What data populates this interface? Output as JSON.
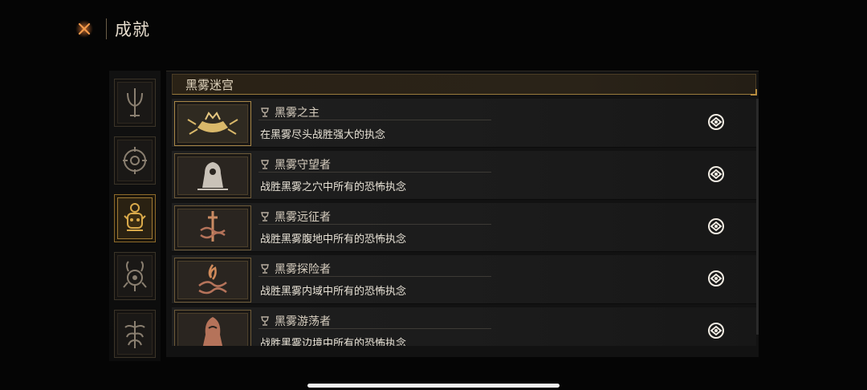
{
  "header": {
    "title": "成就",
    "close_icon": "close-x-icon"
  },
  "sidebar": {
    "tabs": [
      {
        "icon": "trident-icon",
        "active": false
      },
      {
        "icon": "eye-sigil-icon",
        "active": false
      },
      {
        "icon": "skull-sigil-icon",
        "active": true
      },
      {
        "icon": "horned-sigil-icon",
        "active": false
      },
      {
        "icon": "tree-sigil-icon",
        "active": false
      }
    ]
  },
  "section": {
    "title": "黑雾迷宫"
  },
  "achievements": [
    {
      "name": "黑雾之主",
      "desc": "在黑雾尽头战胜强大的执念",
      "icon": "crown-crab-icon",
      "highlight": true
    },
    {
      "name": "黑雾守望者",
      "desc": "战胜黑雾之穴中所有的恐怖执念",
      "icon": "hooded-figure-icon",
      "highlight": false
    },
    {
      "name": "黑雾远征者",
      "desc": "战胜黑雾腹地中所有的恐怖执念",
      "icon": "sword-knot-icon",
      "highlight": false
    },
    {
      "name": "黑雾探险者",
      "desc": "战胜黑雾内域中所有的恐怖执念",
      "icon": "flame-knot-icon",
      "highlight": false
    },
    {
      "name": "黑雾游荡者",
      "desc": "战胜黑雾边境中所有的恐怖执念",
      "icon": "cloaked-figure-icon",
      "highlight": false
    }
  ],
  "colors": {
    "accent_gold": "#b98d3f",
    "active_tab": "#a07a35"
  }
}
